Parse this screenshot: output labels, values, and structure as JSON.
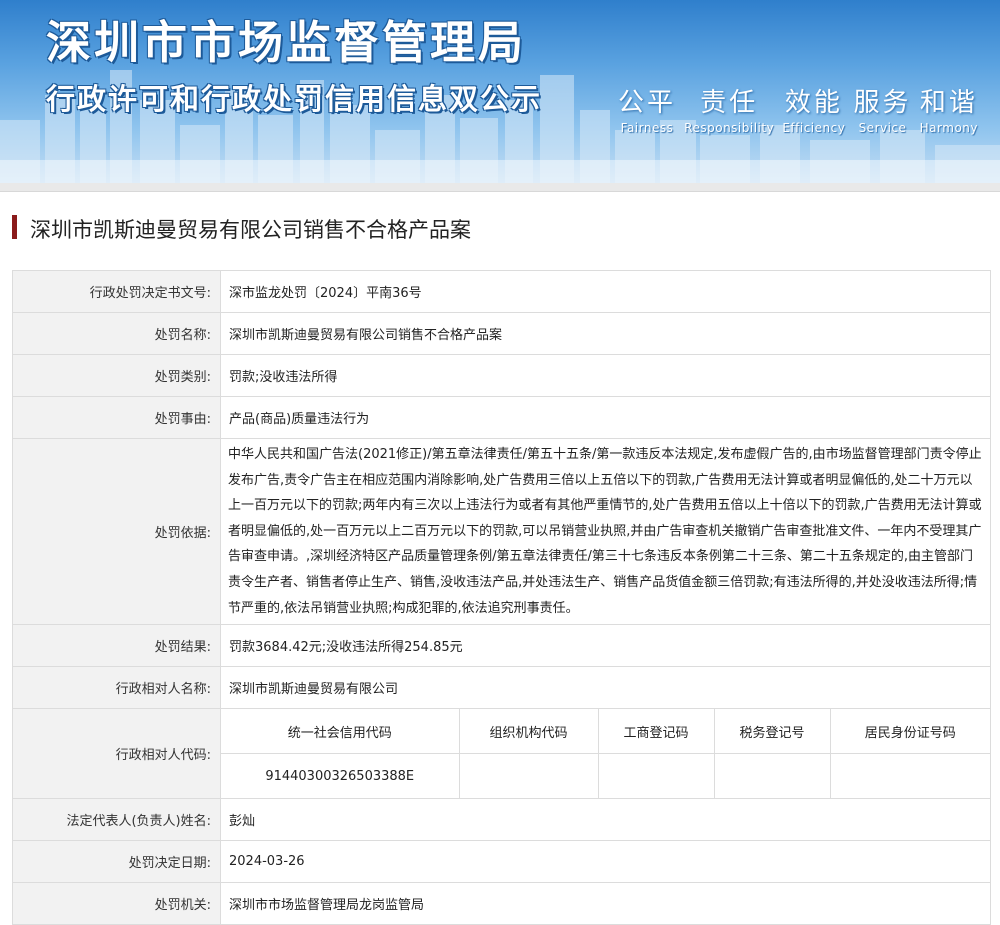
{
  "banner": {
    "title": "深圳市市场监督管理局",
    "subtitle": "行政许可和行政处罚信用信息双公示",
    "mottos": [
      {
        "cn": "公平",
        "en": "Fairness"
      },
      {
        "cn": "责任",
        "en": "Responsibility"
      },
      {
        "cn": "效能",
        "en": "Efficiency"
      },
      {
        "cn": "服务",
        "en": "Service"
      },
      {
        "cn": "和谐",
        "en": "Harmony"
      }
    ]
  },
  "case_title": "深圳市凯斯迪曼贸易有限公司销售不合格产品案",
  "fields": {
    "doc_no": {
      "label": "行政处罚决定书文号:",
      "value": "深市监龙处罚〔2024〕平南36号"
    },
    "case_name": {
      "label": "处罚名称:",
      "value": "深圳市凯斯迪曼贸易有限公司销售不合格产品案"
    },
    "category": {
      "label": "处罚类别:",
      "value": "罚款;没收违法所得"
    },
    "reason": {
      "label": "处罚事由:",
      "value": "产品(商品)质量违法行为"
    },
    "basis": {
      "label": "处罚依据:",
      "value": "中华人民共和国广告法(2021修正)/第五章法律责任/第五十五条/第一款违反本法规定,发布虚假广告的,由市场监督管理部门责令停止发布广告,责令广告主在相应范围内消除影响,处广告费用三倍以上五倍以下的罚款,广告费用无法计算或者明显偏低的,处二十万元以上一百万元以下的罚款;两年内有三次以上违法行为或者有其他严重情节的,处广告费用五倍以上十倍以下的罚款,广告费用无法计算或者明显偏低的,处一百万元以上二百万元以下的罚款,可以吊销营业执照,并由广告审查机关撤销广告审查批准文件、一年内不受理其广告审查申请。,深圳经济特区产品质量管理条例/第五章法律责任/第三十七条违反本条例第二十三条、第二十五条规定的,由主管部门责令生产者、销售者停止生产、销售,没收违法产品,并处违法生产、销售产品货值金额三倍罚款;有违法所得的,并处没收违法所得;情节严重的,依法吊销营业执照;构成犯罪的,依法追究刑事责任。"
    },
    "result": {
      "label": "处罚结果:",
      "value": "罚款3684.42元;没收违法所得254.85元"
    },
    "party_name": {
      "label": "行政相对人名称:",
      "value": "深圳市凯斯迪曼贸易有限公司"
    },
    "party_code": {
      "label": "行政相对人代码:",
      "headers": [
        "统一社会信用代码",
        "组织机构代码",
        "工商登记码",
        "税务登记号",
        "居民身份证号码"
      ],
      "values": [
        "91440300326503388E",
        "",
        "",
        "",
        ""
      ]
    },
    "legal_rep": {
      "label": "法定代表人(负责人)姓名:",
      "value": "彭灿"
    },
    "date": {
      "label": "处罚决定日期:",
      "value": "2024-03-26"
    },
    "authority": {
      "label": "处罚机关:",
      "value": "深圳市市场监督管理局龙岗监管局"
    }
  }
}
